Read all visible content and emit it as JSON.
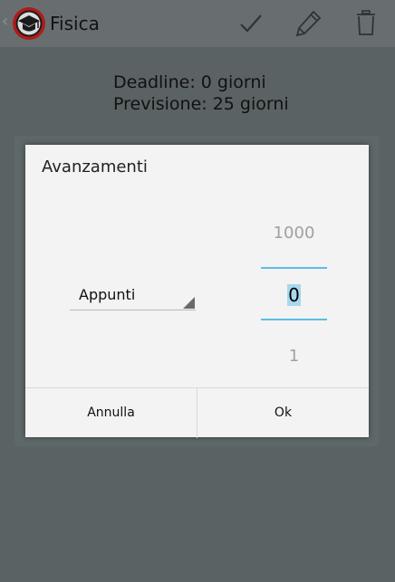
{
  "action_bar": {
    "title": "Fisica",
    "up_glyph": "‹",
    "icons": [
      "app-logo-icon",
      "check-icon",
      "pencil-icon",
      "trash-icon"
    ]
  },
  "info": {
    "deadline": "Deadline: 0 giorni",
    "previsione": "Previsione: 25 giorni"
  },
  "dialog": {
    "title": "Avanzamenti",
    "spinner_value": "Appunti",
    "picker": {
      "prev": "1000",
      "current": "0",
      "next": "1"
    },
    "buttons": {
      "cancel": "Annulla",
      "ok": "Ok"
    }
  },
  "colors": {
    "action_bar": "#686e6f",
    "background": "#5a6264",
    "dialog": "#f3f3f3",
    "accent": "#5cbde4",
    "selection": "#a6d8ee"
  }
}
